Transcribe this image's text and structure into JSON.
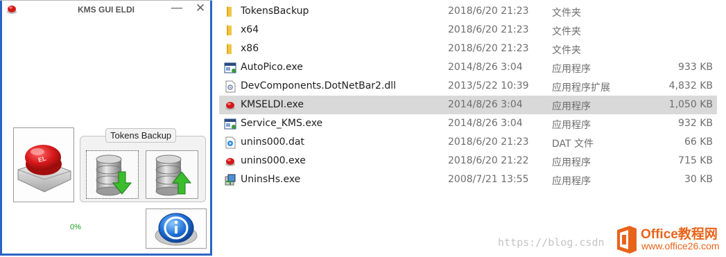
{
  "kms_window": {
    "title": "KMS GUI ELDI",
    "minimize_glyph": "—",
    "close_glyph": "✕",
    "tokens_group_label": "Tokens Backup",
    "progress_text": "0%",
    "big_button_label": "EL",
    "big_button_icon": "red-activate-button-icon",
    "backup_icon": "database-arrow-down-icon",
    "restore_icon": "database-arrow-up-icon",
    "info_icon": "info-icon"
  },
  "file_list": {
    "rows": [
      {
        "name": "TokensBackup",
        "date": "2018/6/20 21:23",
        "type": "文件夹",
        "size": "",
        "icon": "folder-icon"
      },
      {
        "name": "x64",
        "date": "2018/6/20 21:23",
        "type": "文件夹",
        "size": "",
        "icon": "folder-icon"
      },
      {
        "name": "x86",
        "date": "2018/6/20 21:23",
        "type": "文件夹",
        "size": "",
        "icon": "folder-icon"
      },
      {
        "name": "AutoPico.exe",
        "date": "2014/8/26 3:04",
        "type": "应用程序",
        "size": "933 KB",
        "icon": "app-window-icon"
      },
      {
        "name": "DevComponents.DotNetBar2.dll",
        "date": "2013/5/22 10:39",
        "type": "应用程序扩展",
        "size": "4,832 KB",
        "icon": "dll-file-icon"
      },
      {
        "name": "KMSELDI.exe",
        "date": "2014/8/26 3:04",
        "type": "应用程序",
        "size": "1,050 KB",
        "icon": "red-button-exe-icon",
        "selected": true
      },
      {
        "name": "Service_KMS.exe",
        "date": "2014/8/26 3:04",
        "type": "应用程序",
        "size": "932 KB",
        "icon": "app-window-icon"
      },
      {
        "name": "unins000.dat",
        "date": "2018/6/20 21:23",
        "type": "DAT 文件",
        "size": "66 KB",
        "icon": "media-file-icon"
      },
      {
        "name": "unins000.exe",
        "date": "2018/6/20 21:22",
        "type": "应用程序",
        "size": "715 KB",
        "icon": "red-button-exe-icon"
      },
      {
        "name": "UninsHs.exe",
        "date": "2008/7/21 13:55",
        "type": "应用程序",
        "size": "30 KB",
        "icon": "installer-icon"
      }
    ]
  },
  "watermark": {
    "url_text": "https://blog.csdn",
    "logo_line1": "Office教程网",
    "logo_line2": "www.office26.com"
  },
  "colors": {
    "window_border": "#2b63c4",
    "selected_row": "#d9d9d9",
    "folder": "#f4c542",
    "progress_green": "#1a9a1a",
    "logo_orange": "#e8641b"
  }
}
